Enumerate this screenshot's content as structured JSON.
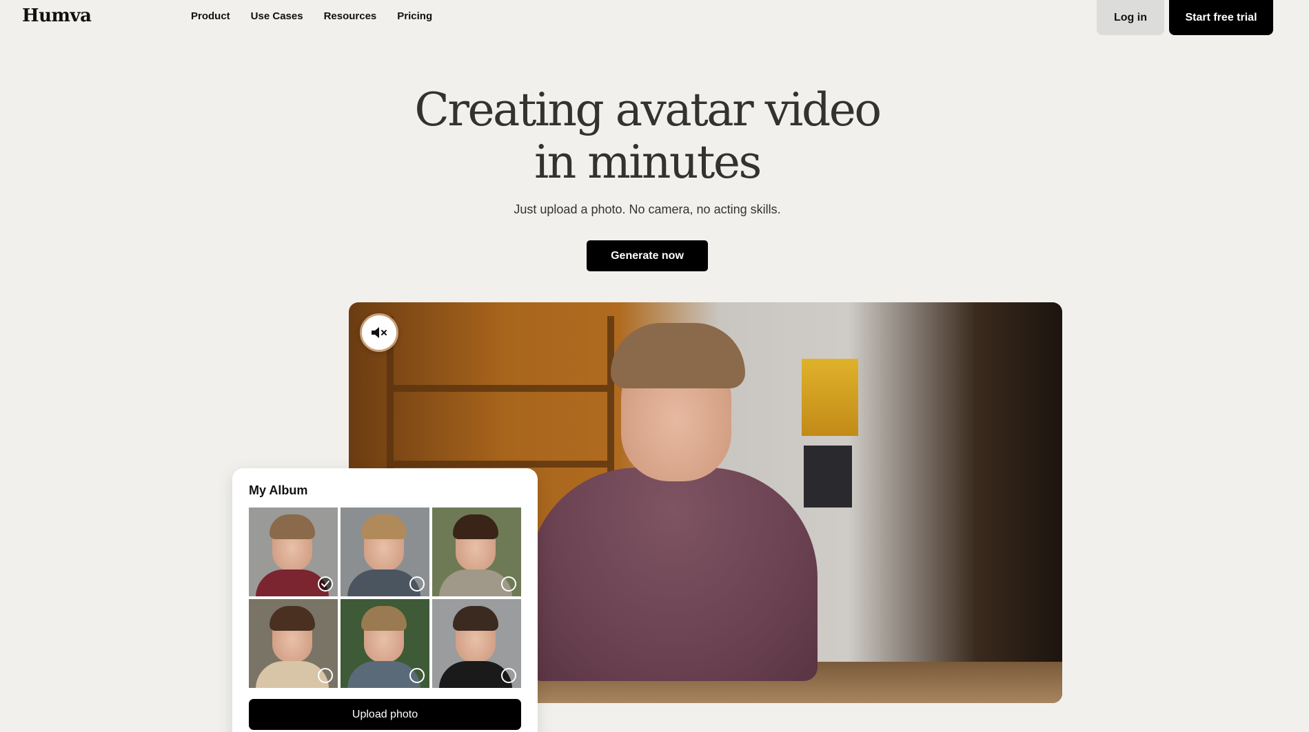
{
  "header": {
    "logo": "Humva",
    "nav": [
      "Product",
      "Use Cases",
      "Resources",
      "Pricing"
    ],
    "login_label": "Log in",
    "trial_label": "Start free trial"
  },
  "hero": {
    "title_line1": "Creating avatar video",
    "title_line2": "in minutes",
    "subtitle": "Just upload a photo. No camera, no acting skills.",
    "cta_label": "Generate now"
  },
  "video": {
    "mute_icon": "speaker-muted-icon",
    "muted": true
  },
  "album": {
    "title": "My Album",
    "upload_label": "Upload photo",
    "photos": [
      {
        "selected": true,
        "bg": "#9a9a98",
        "hair": "#8a6a4a",
        "shirt": "#7a2530"
      },
      {
        "selected": false,
        "bg": "#8c8f92",
        "hair": "#b08a5a",
        "shirt": "#4a5560"
      },
      {
        "selected": false,
        "bg": "#6e7a55",
        "hair": "#3a2418",
        "shirt": "#a09888"
      },
      {
        "selected": false,
        "bg": "#7a7466",
        "hair": "#4a3020",
        "shirt": "#d8c4a6"
      },
      {
        "selected": false,
        "bg": "#3e5a36",
        "hair": "#9a7a50",
        "shirt": "#5a6a78"
      },
      {
        "selected": false,
        "bg": "#9a9c9e",
        "hair": "#3a2a20",
        "shirt": "#1a1a1a"
      }
    ]
  }
}
